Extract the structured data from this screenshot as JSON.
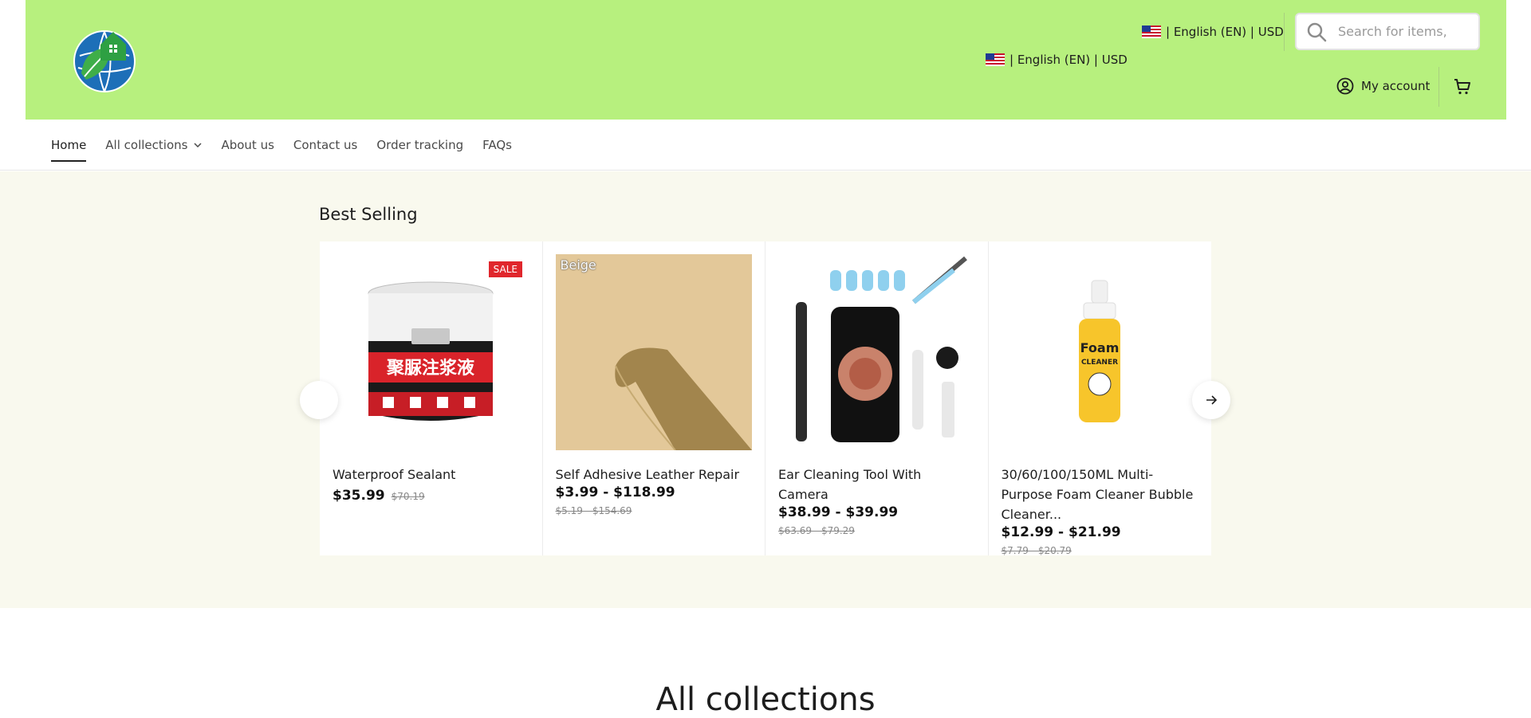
{
  "header": {
    "logo_icon": "globe-house-leaf-logo",
    "lang_top": "| English (EN) | USD",
    "lang_mid": "| English (EN) | USD",
    "search_placeholder": "Search for items,",
    "account_label": "My account",
    "bg_color": "#b7f07e"
  },
  "nav": {
    "items": [
      {
        "label": "Home",
        "active": true
      },
      {
        "label": " All collections"
      },
      {
        "label": "About us"
      },
      {
        "label": "Contact us"
      },
      {
        "label": "Order tracking"
      },
      {
        "label": "FAQs"
      }
    ]
  },
  "best_selling": {
    "title": "Best Selling",
    "products": [
      {
        "title": "Waterproof Sealant",
        "price": "$35.99",
        "old_price": "$70.19",
        "badge": "SALE"
      },
      {
        "title": "Self Adhesive Leather Repair",
        "price": "$3.99 - $118.99",
        "old_price": "$5.19 - $154.69",
        "variant": "Beige"
      },
      {
        "title": "Ear Cleaning Tool With Camera",
        "price": "$38.99 - $39.99",
        "old_price": "$63.69 - $79.29"
      },
      {
        "title": "30/60/100/150ML Multi-Purpose Foam Cleaner Bubble Cleaner...",
        "price": "$12.99 - $21.99",
        "old_price": "$7.79 - $20.79"
      }
    ]
  },
  "all_collections": {
    "title": "All collections"
  }
}
